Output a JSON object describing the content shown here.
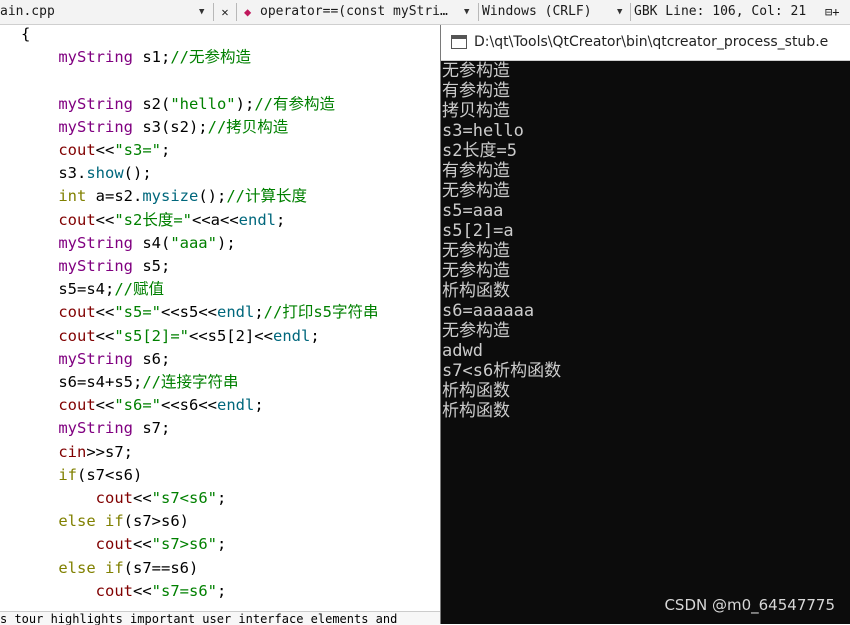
{
  "toolbar": {
    "file_tab": "ain.cpp",
    "close_glyph": "✕",
    "function_symbol": "operator==(const myStri…",
    "line_ending": "Windows (CRLF)",
    "encoding_position": "GBK Line: 106, Col: 21",
    "split_glyph": "⊟+"
  },
  "editor": {
    "lines": [
      [
        [
          "p",
          "{"
        ]
      ],
      [
        [
          "p",
          "    "
        ],
        [
          "t",
          "myString"
        ],
        [
          "p",
          " s1;"
        ],
        [
          "c",
          "//无参构造"
        ]
      ],
      [],
      [
        [
          "p",
          "    "
        ],
        [
          "t",
          "myString"
        ],
        [
          "p",
          " s2("
        ],
        [
          "s",
          "\"hello\""
        ],
        [
          "p",
          ");"
        ],
        [
          "c",
          "//有参构造"
        ]
      ],
      [
        [
          "p",
          "    "
        ],
        [
          "t",
          "myString"
        ],
        [
          "p",
          " s3(s2);"
        ],
        [
          "c",
          "//拷贝构造"
        ]
      ],
      [
        [
          "p",
          "    "
        ],
        [
          "v",
          "cout"
        ],
        [
          "p",
          "<<"
        ],
        [
          "s",
          "\"s3=\""
        ],
        [
          "p",
          ";"
        ]
      ],
      [
        [
          "p",
          "    s3."
        ],
        [
          "f",
          "show"
        ],
        [
          "p",
          "();"
        ]
      ],
      [
        [
          "p",
          "    "
        ],
        [
          "k",
          "int"
        ],
        [
          "p",
          " a=s2."
        ],
        [
          "f",
          "mysize"
        ],
        [
          "p",
          "();"
        ],
        [
          "c",
          "//计算长度"
        ]
      ],
      [
        [
          "p",
          "    "
        ],
        [
          "v",
          "cout"
        ],
        [
          "p",
          "<<"
        ],
        [
          "s",
          "\"s2长度=\""
        ],
        [
          "p",
          "<<a<<"
        ],
        [
          "f",
          "endl"
        ],
        [
          "p",
          ";"
        ]
      ],
      [
        [
          "p",
          "    "
        ],
        [
          "t",
          "myString"
        ],
        [
          "p",
          " s4("
        ],
        [
          "s",
          "\"aaa\""
        ],
        [
          "p",
          ");"
        ]
      ],
      [
        [
          "p",
          "    "
        ],
        [
          "t",
          "myString"
        ],
        [
          "p",
          " s5;"
        ]
      ],
      [
        [
          "p",
          "    s5=s4;"
        ],
        [
          "c",
          "//赋值"
        ]
      ],
      [
        [
          "p",
          "    "
        ],
        [
          "v",
          "cout"
        ],
        [
          "p",
          "<<"
        ],
        [
          "s",
          "\"s5=\""
        ],
        [
          "p",
          "<<s5<<"
        ],
        [
          "f",
          "endl"
        ],
        [
          "p",
          ";"
        ],
        [
          "c",
          "//打印s5字符串"
        ]
      ],
      [
        [
          "p",
          "    "
        ],
        [
          "v",
          "cout"
        ],
        [
          "p",
          "<<"
        ],
        [
          "s",
          "\"s5[2]=\""
        ],
        [
          "p",
          "<<s5[2]<<"
        ],
        [
          "f",
          "endl"
        ],
        [
          "p",
          ";"
        ]
      ],
      [
        [
          "p",
          "    "
        ],
        [
          "t",
          "myString"
        ],
        [
          "p",
          " s6;"
        ]
      ],
      [
        [
          "p",
          "    s6=s4+s5;"
        ],
        [
          "c",
          "//连接字符串"
        ]
      ],
      [
        [
          "p",
          "    "
        ],
        [
          "v",
          "cout"
        ],
        [
          "p",
          "<<"
        ],
        [
          "s",
          "\"s6=\""
        ],
        [
          "p",
          "<<s6<<"
        ],
        [
          "f",
          "endl"
        ],
        [
          "p",
          ";"
        ]
      ],
      [
        [
          "p",
          "    "
        ],
        [
          "t",
          "myString"
        ],
        [
          "p",
          " s7;"
        ]
      ],
      [
        [
          "p",
          "    "
        ],
        [
          "v",
          "cin"
        ],
        [
          "p",
          ">>s7;"
        ]
      ],
      [
        [
          "p",
          "    "
        ],
        [
          "k",
          "if"
        ],
        [
          "p",
          "(s7<s6)"
        ]
      ],
      [
        [
          "p",
          "        "
        ],
        [
          "v",
          "cout"
        ],
        [
          "p",
          "<<"
        ],
        [
          "s",
          "\"s7<s6\""
        ],
        [
          "p",
          ";"
        ]
      ],
      [
        [
          "p",
          "    "
        ],
        [
          "k",
          "else"
        ],
        [
          "p",
          " "
        ],
        [
          "k",
          "if"
        ],
        [
          "p",
          "(s7>s6)"
        ]
      ],
      [
        [
          "p",
          "        "
        ],
        [
          "v",
          "cout"
        ],
        [
          "p",
          "<<"
        ],
        [
          "s",
          "\"s7>s6\""
        ],
        [
          "p",
          ";"
        ]
      ],
      [
        [
          "p",
          "    "
        ],
        [
          "k",
          "else"
        ],
        [
          "p",
          " "
        ],
        [
          "k",
          "if"
        ],
        [
          "p",
          "(s7==s6)"
        ]
      ],
      [
        [
          "p",
          "        "
        ],
        [
          "v",
          "cout"
        ],
        [
          "p",
          "<<"
        ],
        [
          "s",
          "\"s7=s6\""
        ],
        [
          "p",
          ";"
        ]
      ]
    ]
  },
  "status_text": "s tour highlights important user interface elements and",
  "console": {
    "title": "D:\\qt\\Tools\\QtCreator\\bin\\qtcreator_process_stub.e",
    "output": [
      "无参构造",
      "有参构造",
      "拷贝构造",
      "s3=hello",
      "s2长度=5",
      "有参构造",
      "无参构造",
      "s5=aaa",
      "s5[2]=a",
      "无参构造",
      "无参构造",
      "析构函数",
      "s6=aaaaaa",
      "无参构造",
      "adwd",
      "s7<s6析构函数",
      "析构函数",
      "析构函数"
    ]
  },
  "watermark": "CSDN @m0_64547775",
  "colors": {
    "type": "#800080",
    "keyword": "#808000",
    "string": "#008000",
    "comment": "#008000",
    "function": "#00677c",
    "variable": "#800000",
    "console_bg": "#0c0c0c",
    "console_text": "#cccccc"
  },
  "icons": {
    "function_marker": "diamond-icon",
    "console": "console-window-icon"
  }
}
